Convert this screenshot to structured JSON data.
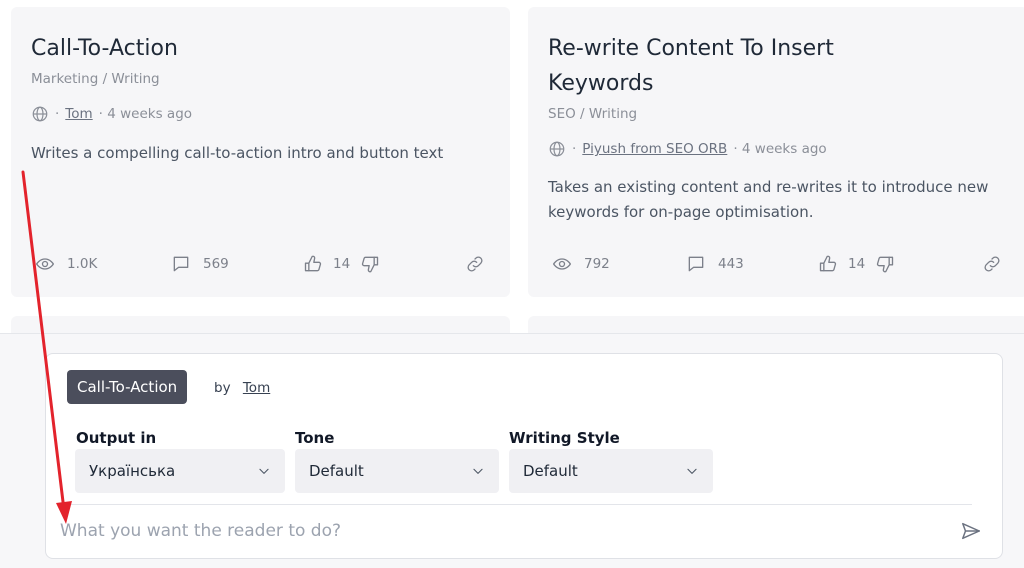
{
  "cards": [
    {
      "title": "Call-To-Action",
      "category": "Marketing / Writing",
      "author": "Tom",
      "age": "· 4 weeks ago",
      "description": "Writes a compelling call-to-action intro and button text",
      "views": "1.0K",
      "comments": "569",
      "likes": "14"
    },
    {
      "title": "Re-write Content To Insert Keywords",
      "category": "SEO / Writing",
      "author": "Piyush from SEO ORB",
      "age": "· 4 weeks ago",
      "description": "Takes an existing content and re-writes it to introduce new keywords for on-page optimisation.",
      "views": "792",
      "comments": "443",
      "likes": "14"
    }
  ],
  "form": {
    "prompt_tag": "Call-To-Action",
    "by_label": "by",
    "author": "Tom",
    "output_label": "Output in",
    "output_value": "Українська",
    "tone_label": "Tone",
    "tone_value": "Default",
    "style_label": "Writing Style",
    "style_value": "Default",
    "input_placeholder": "What you want the reader to do?"
  },
  "icons": {
    "globe": "globe-icon",
    "eye": "eye-icon",
    "comment": "comment-icon",
    "thumbs_up": "thumbs-up-icon",
    "thumbs_down": "thumbs-down-icon",
    "link": "link-icon",
    "chevron": "chevron-down-icon",
    "send": "send-icon"
  },
  "colors": {
    "tag_bg": "#4b4e5c",
    "annotation_arrow": "#e3232c"
  }
}
